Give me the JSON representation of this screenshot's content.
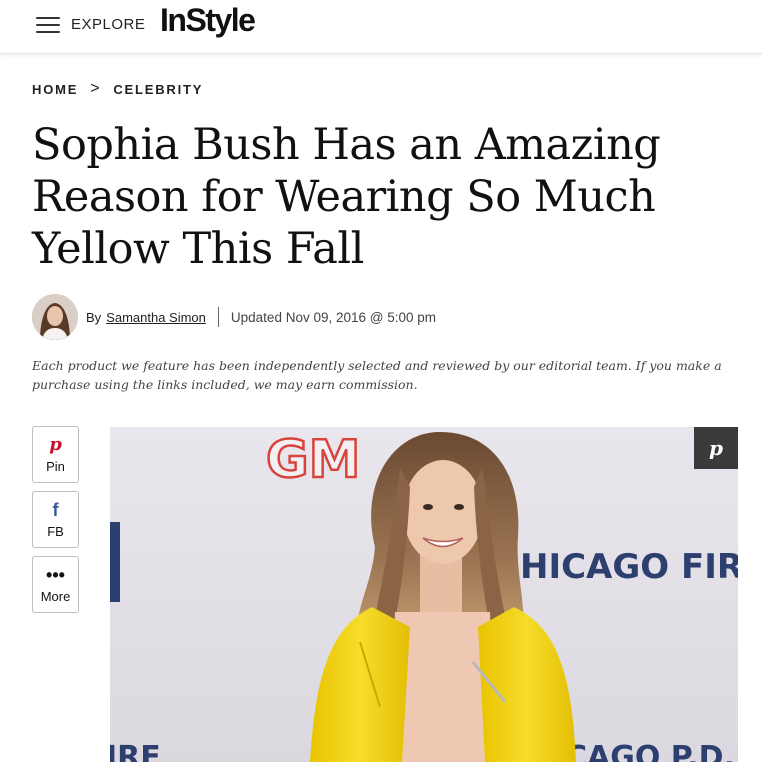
{
  "header": {
    "explore_label": "EXPLORE",
    "logo_text": "InStyle"
  },
  "breadcrumb": {
    "items": [
      "HOME",
      "CELEBRITY"
    ],
    "separator": ">"
  },
  "article": {
    "headline": "Sophia Bush Has an Amazing Reason for Wearing So Much Yellow This Fall",
    "byline_prefix": "By",
    "author": "Samantha Simon",
    "updated": "Updated Nov 09, 2016 @ 5:00 pm",
    "disclaimer": "Each product we feature has been independently selected and reviewed by our editorial team. If you make a purchase using the links included, we may earn commission."
  },
  "share": {
    "pin": {
      "icon": "pinterest-icon",
      "label": "Pin"
    },
    "fb": {
      "icon": "facebook-icon",
      "label": "FB"
    },
    "more": {
      "icon": "more-dots-icon",
      "label": "More"
    }
  },
  "hero_image": {
    "backdrop_text_left": "GM",
    "backdrop_text_right": "HICAGO FIRE",
    "backdrop_text_bottom": "CAGO P.D.",
    "jacket_color": "#f2d321"
  },
  "colors": {
    "pinterest": "#c8102e",
    "facebook": "#3b5998",
    "gm_red": "#d8443c",
    "chicago_fire_blue": "#2c3f6e"
  }
}
